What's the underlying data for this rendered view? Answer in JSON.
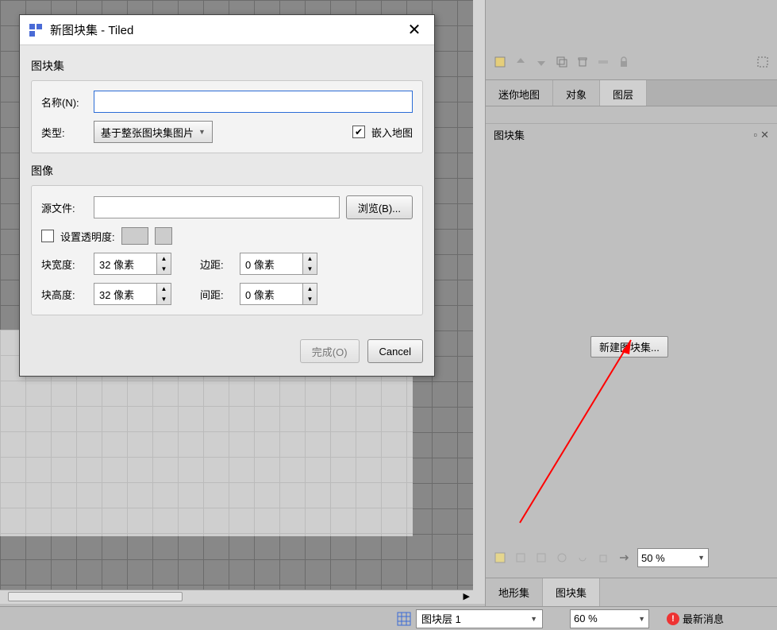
{
  "dialog": {
    "title": "新图块集 - Tiled",
    "group_tileset": "图块集",
    "name_label": "名称(N):",
    "name_value": "",
    "type_label": "类型:",
    "type_value": "基于整张图块集图片",
    "embed_label": "嵌入地图",
    "embed_checked": true,
    "group_image": "图像",
    "source_label": "源文件:",
    "source_value": "",
    "browse_btn": "浏览(B)...",
    "transparency_label": "设置透明度:",
    "transparency_checked": false,
    "tile_width_label": "块宽度:",
    "tile_width_value": "32 像素",
    "margin_label": "边距:",
    "margin_value": "0 像素",
    "tile_height_label": "块高度:",
    "tile_height_value": "32 像素",
    "spacing_label": "间距:",
    "spacing_value": "0 像素",
    "finish_btn": "完成(O)",
    "cancel_btn": "Cancel"
  },
  "right_panel": {
    "tabs": [
      "迷你地图",
      "对象",
      "图层"
    ],
    "panel_title": "图块集",
    "new_tileset_btn": "新建图块集...",
    "bottom_tabs": [
      "地形集",
      "图块集"
    ],
    "zoom": "50 %"
  },
  "status": {
    "layer": "图块层 1",
    "zoom": "60 %",
    "news": "最新消息"
  }
}
